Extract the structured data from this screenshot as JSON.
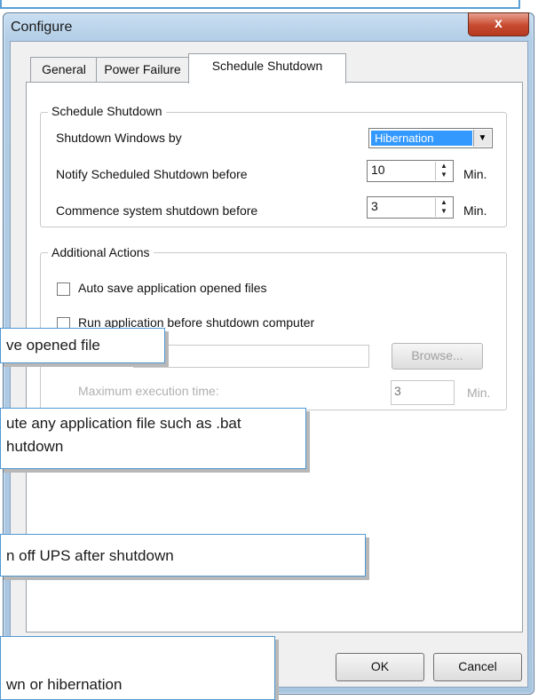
{
  "window": {
    "title": "Configure",
    "close_glyph": "x"
  },
  "tabs": [
    {
      "label": "General"
    },
    {
      "label": "Power Failure"
    },
    {
      "label": "Schedule Shutdown",
      "active": true
    }
  ],
  "schedule_group": {
    "title": "Schedule Shutdown",
    "shutdown_by_label": "Shutdown Windows by",
    "shutdown_by_value": "Hibernation",
    "notify_label": "Notify Scheduled Shutdown before",
    "notify_value": "10",
    "notify_unit": "Min.",
    "commence_label": "Commence system shutdown before",
    "commence_value": "3",
    "commence_unit": "Min."
  },
  "additional_group": {
    "title": "Additional Actions",
    "auto_save_label": "Auto save application opened files",
    "auto_save_checked": false,
    "run_app_label": "Run application before shutdown computer",
    "run_app_checked": false,
    "browse_label": "Browse...",
    "max_exec_label": "Maximum execution time:",
    "max_exec_value": "3",
    "max_exec_unit": "Min."
  },
  "buttons": {
    "ok": "OK",
    "cancel": "Cancel"
  },
  "callouts": {
    "c1": "ve opened file",
    "c2_line1": "ute any application file such as .bat",
    "c2_line2": "hutdown",
    "c3": "n off UPS after shutdown",
    "c4": "wn or hibernation"
  },
  "colors": {
    "accent": "#3399ff",
    "callout_border": "#4f97d3",
    "close_button": "#c74a2f"
  }
}
